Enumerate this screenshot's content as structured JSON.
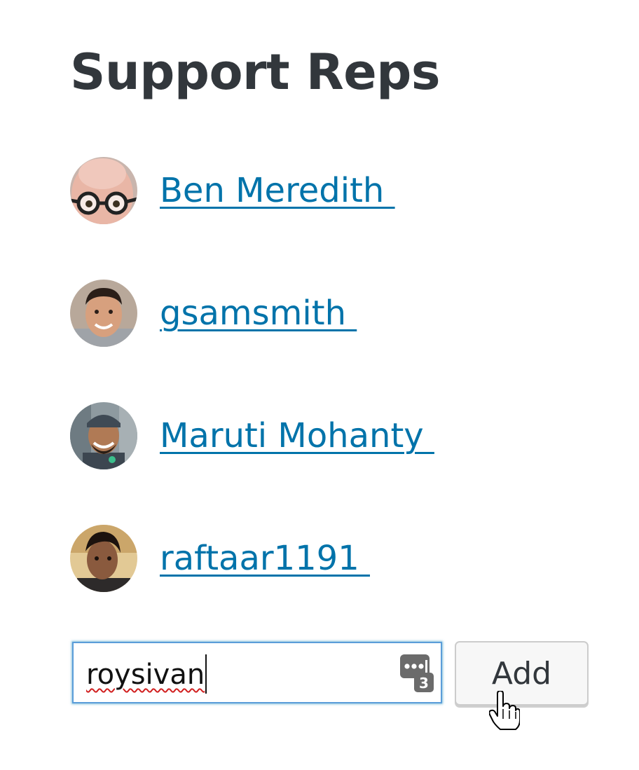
{
  "title": "Support Reps",
  "reps": [
    {
      "name": "Ben Meredith ",
      "avatar": "avatar-ben-meredith"
    },
    {
      "name": "gsamsmith ",
      "avatar": "avatar-gsamsmith"
    },
    {
      "name": "Maruti Mohanty ",
      "avatar": "avatar-maruti-mohanty"
    },
    {
      "name": "raftaar1191 ",
      "avatar": "avatar-raftaar1191"
    }
  ],
  "add_form": {
    "input_value": "roysivan",
    "password_manager_icon": "lastpass-icon",
    "password_manager_count": "3",
    "add_label": "Add"
  },
  "colors": {
    "link": "#0073aa",
    "title": "#32373c",
    "input_focus_border": "#5b9dd9"
  }
}
